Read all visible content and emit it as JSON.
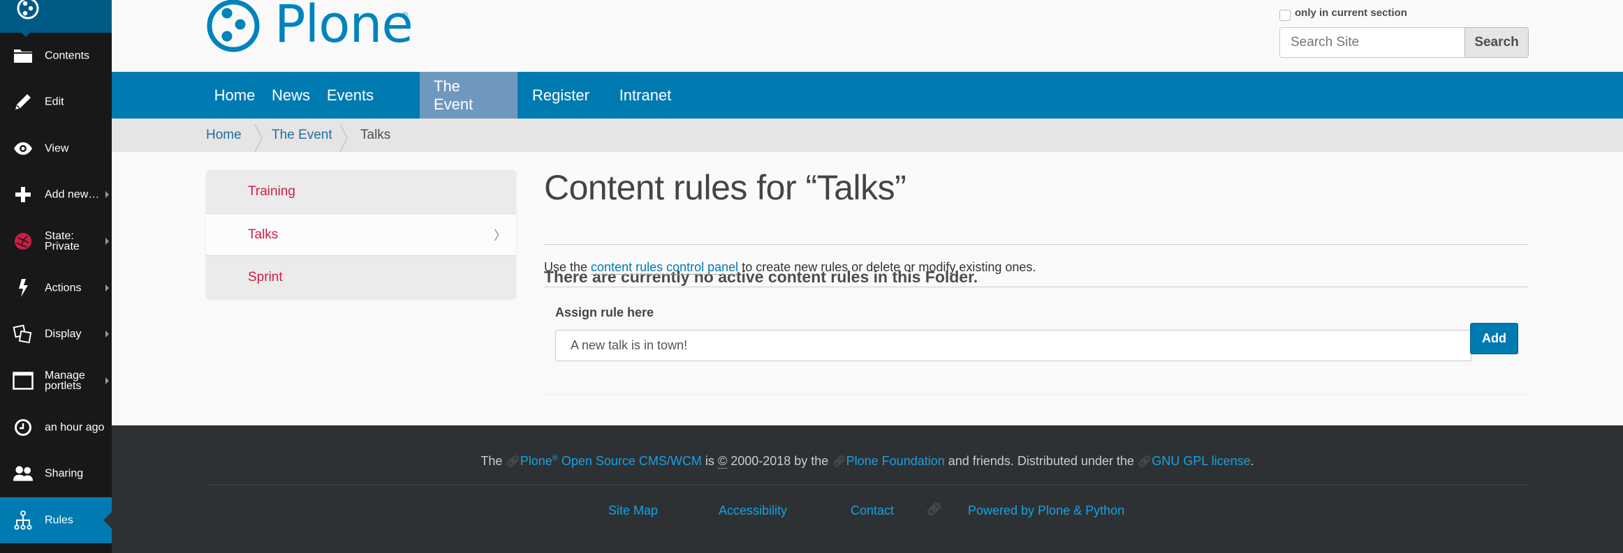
{
  "toolbar": {
    "items": [
      {
        "label": "Contents",
        "icon": "folder-icon",
        "submenu": false
      },
      {
        "label": "Edit",
        "icon": "pencil-icon",
        "submenu": false
      },
      {
        "label": "View",
        "icon": "eye-icon",
        "submenu": false
      },
      {
        "label": "Add new…",
        "icon": "plus-icon",
        "submenu": true
      },
      {
        "label": "State:",
        "label2": "Private",
        "icon": "state-private-icon",
        "submenu": true
      },
      {
        "label": "Actions",
        "icon": "lightning-icon",
        "submenu": true
      },
      {
        "label": "Display",
        "icon": "display-icon",
        "submenu": true
      },
      {
        "label": "Manage",
        "label2": "portlets",
        "icon": "portlets-icon",
        "submenu": true
      },
      {
        "label": "an hour ago",
        "icon": "clock-icon",
        "submenu": false
      },
      {
        "label": "Sharing",
        "icon": "users-icon",
        "submenu": false
      },
      {
        "label": "Rules",
        "icon": "rules-icon",
        "submenu": false,
        "active": true
      }
    ]
  },
  "header": {
    "logo_text": "Plone",
    "logo_reg": "®",
    "search": {
      "checkbox_label": "only in current section",
      "checkbox_checked": false,
      "placeholder": "Search Site",
      "value": "",
      "button_label": "Search"
    }
  },
  "nav": {
    "items": [
      {
        "label": "Home",
        "active": false
      },
      {
        "label": "News",
        "active": false
      },
      {
        "label": "Events",
        "active": false
      },
      {
        "label": "The Event",
        "active": true
      },
      {
        "label": "Register",
        "active": false
      },
      {
        "label": "Intranet",
        "active": false
      }
    ]
  },
  "breadcrumbs": [
    {
      "label": "Home",
      "link": true
    },
    {
      "label": "The Event",
      "link": true
    },
    {
      "label": "Talks",
      "link": false
    }
  ],
  "portlet": {
    "items": [
      {
        "label": "Training",
        "current": false
      },
      {
        "label": "Talks",
        "current": true
      },
      {
        "label": "Sprint",
        "current": false
      }
    ]
  },
  "main": {
    "title": "Content rules for “Talks”",
    "subtitle": "There are currently no active content rules in this Folder.",
    "desc_before": "Use the ",
    "desc_link": "content rules control panel",
    "desc_after": " to create new rules or delete or modify existing ones.",
    "assign": {
      "label": "Assign rule here",
      "selected_value": "A new talk is in town!",
      "button_label": "Add"
    }
  },
  "footer": {
    "colophon": {
      "t1": "The ",
      "plone_link": "Plone",
      "reg": "®",
      "cms_link": " Open Source CMS/WCM",
      "t2": " is ",
      "copy": "©",
      "t3": " 2000-2018 by the ",
      "foundation_link": "Plone Foundation",
      "t4": " and friends. Distributed under the ",
      "gpl_link": "GNU GPL license",
      "t5": "."
    },
    "links": [
      "Site Map",
      "Accessibility",
      "Contact",
      "Powered by Plone & Python"
    ]
  },
  "colors": {
    "brand_blue": "#007bb1",
    "toolbar_bg": "#181818",
    "active_nav": "#6f98be",
    "portlet_link": "#cf1d43",
    "footer_bg": "#2e3133",
    "footer_link": "#16a1e3"
  }
}
